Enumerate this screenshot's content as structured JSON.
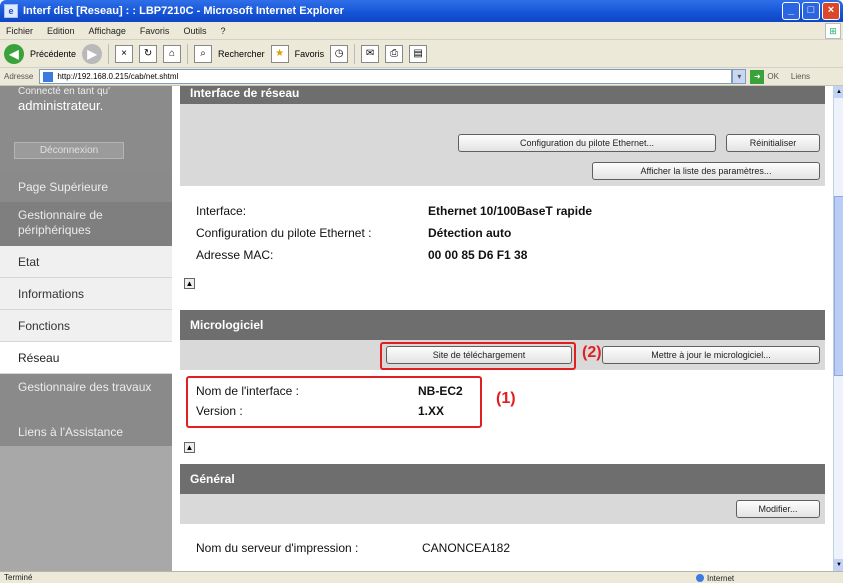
{
  "window": {
    "title": "Interf dist [Reseau] : : LBP7210C - Microsoft Internet Explorer"
  },
  "menu": [
    "Fichier",
    "Edition",
    "Affichage",
    "Favoris",
    "Outils",
    "?"
  ],
  "toolbar": {
    "back_label": "Précédente",
    "search_label": "Rechercher",
    "favorites_label": "Favoris"
  },
  "address": {
    "label": "Adresse",
    "url": "http://192.168.0.215/cab/net.shtml",
    "go_label": "OK",
    "links_label": "Liens"
  },
  "sidebar": {
    "admin_pre": "Connecté en tant qu'",
    "admin_label": "administrateur.",
    "logout_label": "Déconnexion",
    "top_page": "Page Supérieure",
    "device_manager": "Gestionnaire de périphériques",
    "items": [
      {
        "label": "Etat"
      },
      {
        "label": "Informations"
      },
      {
        "label": "Fonctions"
      },
      {
        "label": "Réseau"
      }
    ],
    "jobs_manager": "Gestionnaire des travaux",
    "support_links": "Liens à l'Assistance"
  },
  "network_section": {
    "heading": "Interface de réseau",
    "btn_ethernet_config": "Configuration du pilote Ethernet...",
    "btn_reset": "Réinitialiser",
    "btn_show_params": "Afficher la liste des paramètres...",
    "interface_label": "Interface:",
    "interface_value": "Ethernet 10/100BaseT rapide",
    "driver_label": "Configuration du pilote Ethernet :",
    "driver_value": "Détection auto",
    "mac_label": "Adresse MAC:",
    "mac_value": "00 00 85 D6 F1 38"
  },
  "firmware_section": {
    "heading": "Micrologiciel",
    "btn_download_site": "Site de téléchargement",
    "btn_update_firmware": "Mettre à jour le micrologiciel...",
    "callout_2": "(2)",
    "interface_name_label": "Nom de l'interface :",
    "interface_name_value": "NB-EC2",
    "version_label": "Version :",
    "version_value": "1.XX",
    "callout_1": "(1)"
  },
  "general_section": {
    "heading": "Général",
    "btn_modify": "Modifier...",
    "print_server_label": "Nom du serveur d'impression :",
    "print_server_value": "CANONCEA182"
  },
  "status": {
    "left": "Terminé",
    "zone": "Internet"
  },
  "colors": {
    "accent_red": "#e02020",
    "section_header": "#6e6e6e",
    "sidebar_dark": "#8a8a8a"
  }
}
